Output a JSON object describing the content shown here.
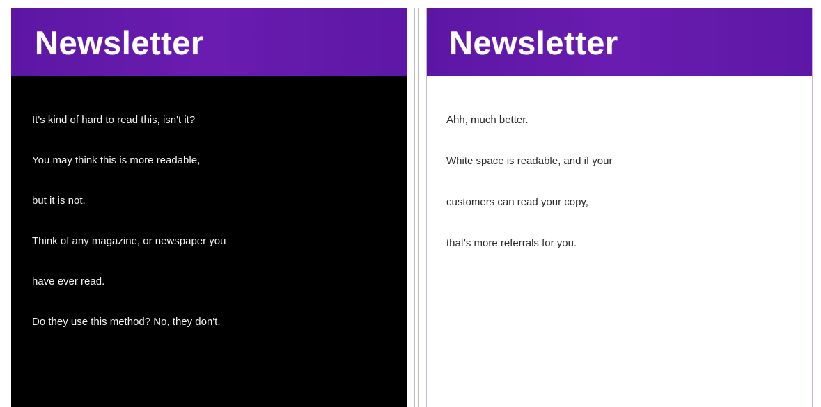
{
  "left_panel": {
    "title": "Newsletter",
    "lines": [
      "It's kind of hard to read this, isn't it?",
      "You may think this is more readable,",
      "but it is not.",
      "Think of any magazine, or newspaper you",
      "have ever read.",
      "Do they use this method? No, they don't."
    ],
    "colors": {
      "background": "#000000",
      "text": "#f2f2f2",
      "banner": "#6a1cb0"
    }
  },
  "right_panel": {
    "title": "Newsletter",
    "lines": [
      "Ahh, much better.",
      "White space is readable, and if your",
      "customers can read your copy,",
      "that's more referrals for you."
    ],
    "colors": {
      "background": "#ffffff",
      "text": "#2a2a2a",
      "banner": "#6a1cb0"
    }
  }
}
